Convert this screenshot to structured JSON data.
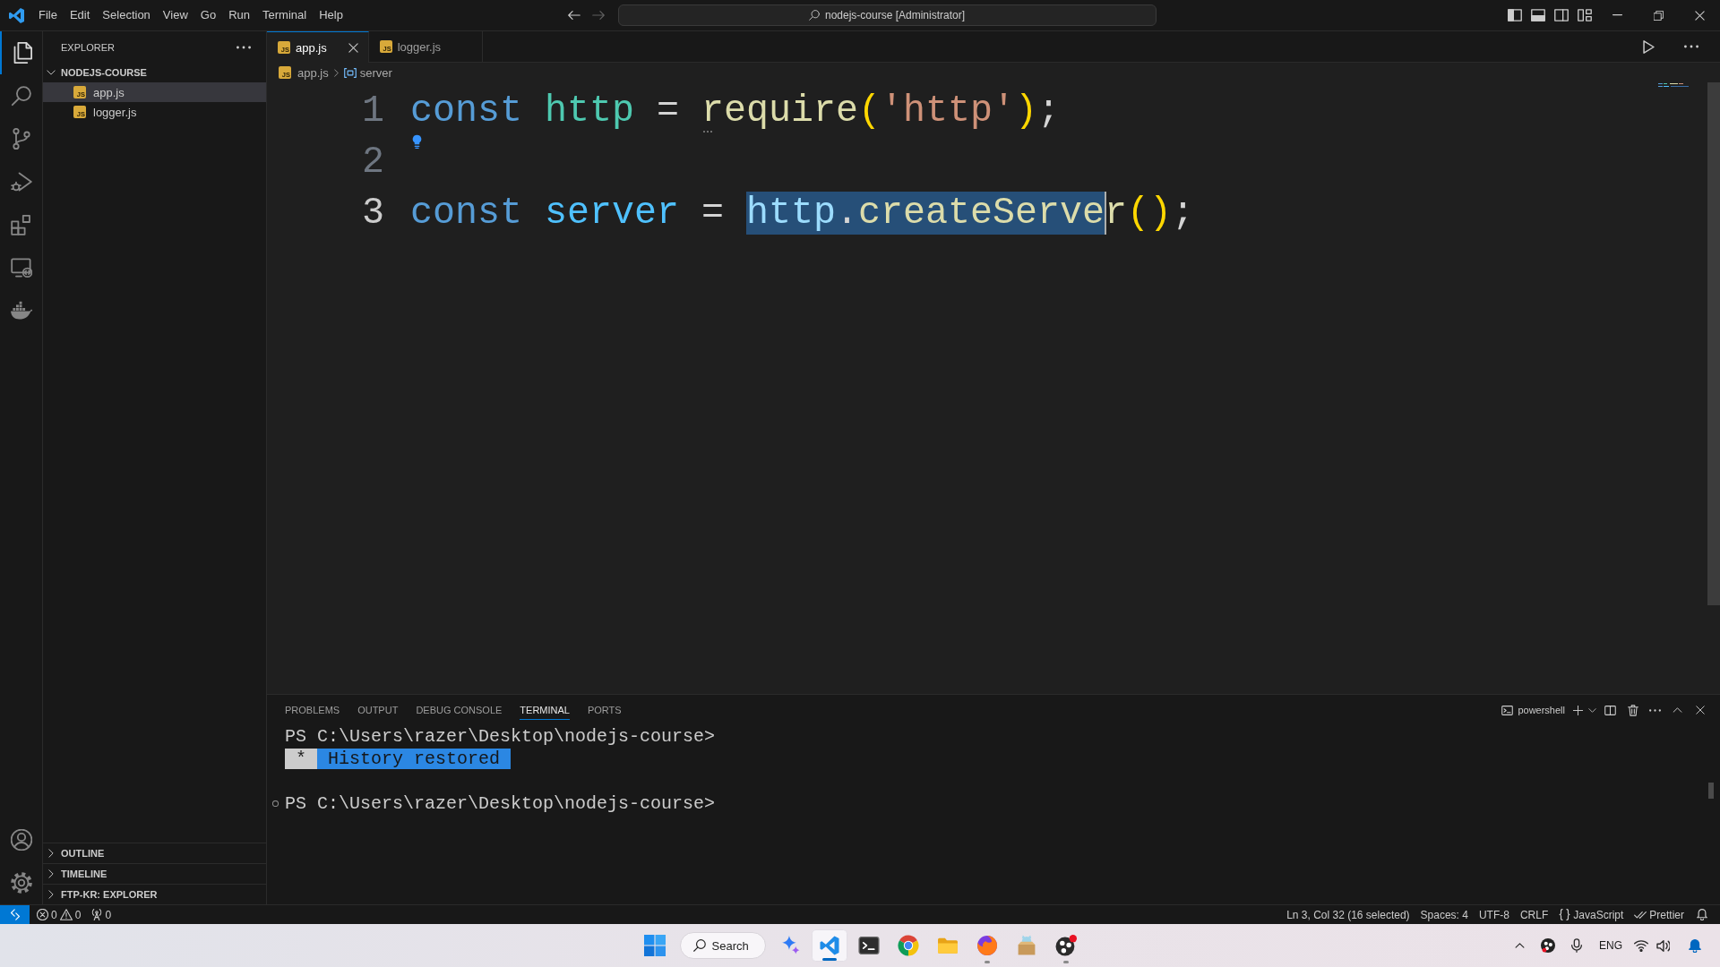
{
  "title_bar": {
    "menu": [
      "File",
      "Edit",
      "Selection",
      "View",
      "Go",
      "Run",
      "Terminal",
      "Help"
    ],
    "navigation": [
      {
        "kind": "back",
        "disabled": false
      },
      {
        "kind": "forward",
        "disabled": true
      }
    ],
    "command_center": "nodejs-course [Administrator]",
    "layout_toggles": [
      {
        "kind": "sidebar",
        "on": true
      },
      {
        "kind": "panel",
        "on": true
      },
      {
        "kind": "secondary",
        "on": false
      }
    ]
  },
  "activity_bar": {
    "items": [
      {
        "kind": "files",
        "selected": true
      },
      {
        "kind": "search",
        "selected": false
      },
      {
        "kind": "source",
        "selected": false
      },
      {
        "kind": "debug",
        "selected": false
      },
      {
        "kind": "extensions",
        "selected": false
      },
      {
        "kind": "remote",
        "selected": false
      },
      {
        "kind": "containers",
        "selected": false
      }
    ]
  },
  "sidebar": {
    "title": "EXPLORER",
    "folder": {
      "label": "NODEJS-COURSE",
      "expanded": true,
      "children": [
        {
          "label": "app.js",
          "icon_label": "JS",
          "selected": true
        },
        {
          "label": "logger.js",
          "icon_label": "JS",
          "selected": false
        }
      ]
    },
    "sections": [
      {
        "label": "OUTLINE",
        "expanded": false
      },
      {
        "label": "TIMELINE",
        "expanded": false
      },
      {
        "label": "FTP-KR: EXPLORER",
        "expanded": false
      }
    ]
  },
  "editor": {
    "tabs": [
      {
        "label": "app.js",
        "icon_label": "JS",
        "selected": true
      },
      {
        "label": "logger.js",
        "icon_label": "JS",
        "selected": false
      }
    ],
    "breadcrumb": {
      "file": "app.js",
      "icon_label": "JS",
      "symbol": "server"
    },
    "lines": [
      {
        "number": "1",
        "current": false,
        "lightbulb": false,
        "tokens": [
          {
            "text": "const ",
            "kind": "keyword",
            "selected": false,
            "hint": false
          },
          {
            "text": "http",
            "kind": "namespace",
            "selected": false,
            "hint": false
          },
          {
            "text": " = ",
            "kind": "operator",
            "selected": false,
            "hint": false
          },
          {
            "text": "require",
            "kind": "function",
            "selected": false,
            "hint": true
          },
          {
            "text": "(",
            "kind": "bracket",
            "selected": false,
            "hint": false
          },
          {
            "text": "'http'",
            "kind": "string",
            "selected": false,
            "hint": false
          },
          {
            "text": ")",
            "kind": "bracket",
            "selected": false,
            "hint": false
          },
          {
            "text": ";",
            "kind": "punctuation",
            "selected": false,
            "hint": false
          }
        ]
      },
      {
        "number": "2",
        "current": false,
        "lightbulb": true
      },
      {
        "number": "3",
        "current": true,
        "lightbulb": false,
        "tokens": [
          {
            "text": "const ",
            "kind": "keyword",
            "selected": false,
            "hint": false
          },
          {
            "text": "server",
            "kind": "constant",
            "selected": false,
            "hint": false
          },
          {
            "text": " = ",
            "kind": "operator",
            "selected": false,
            "hint": false
          },
          {
            "text": "http",
            "kind": "variable",
            "selected": true,
            "hint": false
          },
          {
            "text": ".",
            "kind": "punctuation",
            "selected": true,
            "hint": false
          },
          {
            "text": "createServe",
            "kind": "function",
            "selected": true,
            "hint": false
          },
          {
            "text": "r",
            "kind": "function",
            "selected": false,
            "hint": false
          },
          {
            "text": "()",
            "kind": "bracket",
            "selected": false,
            "hint": false
          },
          {
            "text": ";",
            "kind": "punctuation",
            "selected": false,
            "hint": false
          }
        ]
      }
    ]
  },
  "panel": {
    "tabs": [
      {
        "label": "PROBLEMS",
        "selected": false
      },
      {
        "label": "OUTPUT",
        "selected": false
      },
      {
        "label": "DEBUG CONSOLE",
        "selected": false
      },
      {
        "label": "TERMINAL",
        "selected": true
      },
      {
        "label": "PORTS",
        "selected": false
      }
    ],
    "shell": "powershell",
    "terminal": [
      {
        "kind": "prompt",
        "text": "PS C:\\Users\\razer\\Desktop\\nodejs-course>",
        "decorated": false
      },
      {
        "kind": "notice",
        "icon": "*",
        "text": "History restored"
      },
      {
        "kind": "blank"
      },
      {
        "kind": "prompt",
        "text": "PS C:\\Users\\razer\\Desktop\\nodejs-course>",
        "decorated": true
      }
    ]
  },
  "status_bar": {
    "errors": "0",
    "warnings": "0",
    "ports": "0",
    "items": [
      "Ln 3, Col 32 (16 selected)",
      "Spaces: 4",
      "UTF-8",
      "CRLF"
    ],
    "language": "JavaScript",
    "formatter": "Prettier"
  },
  "taskbar": {
    "search": "Search",
    "apps": [
      {
        "kind": "assistant",
        "running": false,
        "active": false
      },
      {
        "kind": "editor",
        "running": true,
        "active": true
      },
      {
        "kind": "console",
        "running": false,
        "active": false
      },
      {
        "kind": "orb",
        "running": false,
        "active": false
      },
      {
        "kind": "folder",
        "running": false,
        "active": false
      },
      {
        "kind": "fox",
        "running": true,
        "active": false
      },
      {
        "kind": "box",
        "running": false,
        "active": false
      },
      {
        "kind": "recorder",
        "running": true,
        "active": false
      }
    ],
    "input_language": "ENG"
  }
}
